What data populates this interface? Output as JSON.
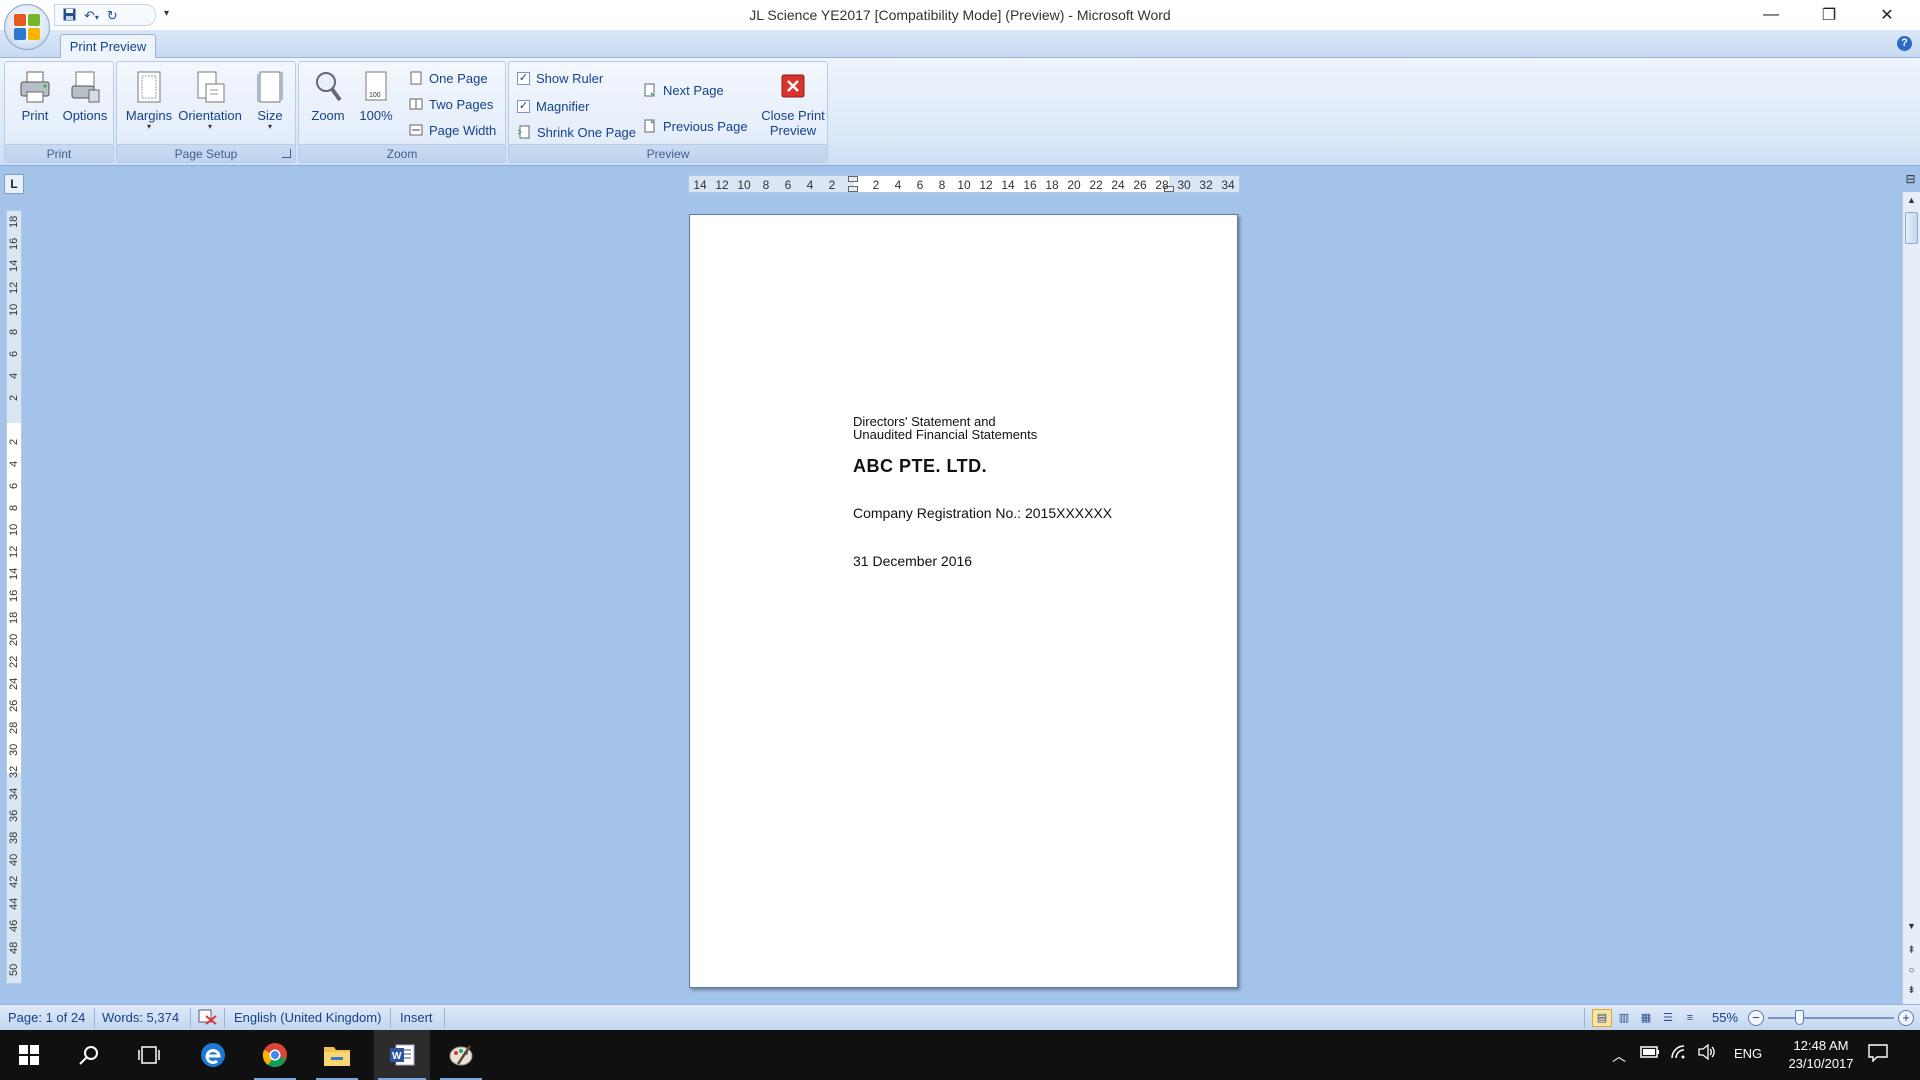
{
  "window": {
    "title": "JL Science YE2017 [Compatibility Mode] (Preview) - Microsoft Word",
    "controls": {
      "minimize": "—",
      "restore": "❐",
      "close": "✕"
    }
  },
  "quick_access": {
    "more": "▾"
  },
  "tabs": [
    {
      "label": "Print Preview",
      "active": true
    }
  ],
  "ribbon": {
    "groups": {
      "print": {
        "label": "Print",
        "print_label": "Print",
        "options_label": "Options"
      },
      "page_setup": {
        "label": "Page Setup",
        "margins_label": "Margins",
        "orientation_label": "Orientation",
        "size_label": "Size"
      },
      "zoom": {
        "label": "Zoom",
        "zoom_label": "Zoom",
        "hundred_label": "100%",
        "one_page_label": "One Page",
        "two_pages_label": "Two Pages",
        "page_width_label": "Page Width"
      },
      "preview": {
        "label": "Preview",
        "show_ruler_label": "Show Ruler",
        "show_ruler_checked": true,
        "magnifier_label": "Magnifier",
        "magnifier_checked": true,
        "shrink_label": "Shrink One Page",
        "next_page_label": "Next Page",
        "previous_page_label": "Previous Page",
        "close_line1": "Close Print",
        "close_line2": "Preview"
      }
    }
  },
  "ruler_corner": "L",
  "horizontal_ruler": [
    "14",
    "12",
    "10",
    "8",
    "6",
    "4",
    "2",
    "",
    "2",
    "4",
    "6",
    "8",
    "10",
    "12",
    "14",
    "16",
    "18",
    "20",
    "22",
    "24",
    "26",
    "28",
    "30",
    "32",
    "34"
  ],
  "vertical_ruler": [
    "18",
    "16",
    "14",
    "12",
    "10",
    "8",
    "6",
    "4",
    "2",
    "",
    "2",
    "4",
    "6",
    "8",
    "10",
    "12",
    "14",
    "16",
    "18",
    "20",
    "22",
    "24",
    "26",
    "28",
    "30",
    "32",
    "34",
    "36",
    "38",
    "40",
    "42",
    "44",
    "46",
    "48",
    "50"
  ],
  "document": {
    "line1": "Directors' Statement and",
    "line2": "Unaudited Financial Statements",
    "company": "ABC PTE. LTD.",
    "registration": "Company Registration No.: 2015XXXXXX",
    "date": "31 December 2016"
  },
  "status_bar": {
    "page": "Page: 1 of 24",
    "words": "Words: 5,374",
    "language": "English (United Kingdom)",
    "mode": "Insert",
    "zoom_level": "55%",
    "zoom_percent": 55
  },
  "taskbar": {
    "language": "ENG",
    "time": "12:48 AM",
    "date": "23/10/2017"
  }
}
